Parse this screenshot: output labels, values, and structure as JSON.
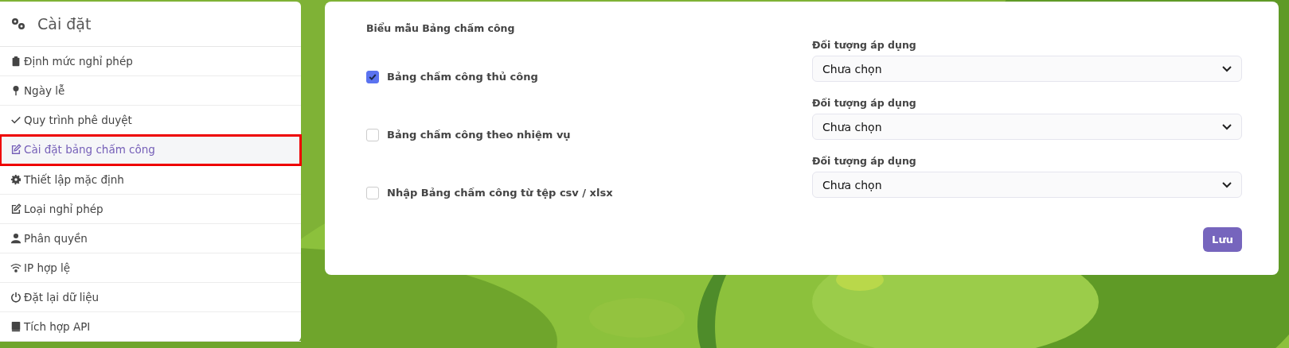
{
  "sidebar": {
    "title": "Cài đặt",
    "items": [
      {
        "label": "Định mức nghỉ phép",
        "selected": false,
        "highlighted": false
      },
      {
        "label": "Ngày lễ",
        "selected": false,
        "highlighted": false
      },
      {
        "label": "Quy trình phê duyệt",
        "selected": false,
        "highlighted": false
      },
      {
        "label": "Cài đặt bảng chấm công",
        "selected": true,
        "highlighted": true
      },
      {
        "label": "Thiết lập mặc định",
        "selected": false,
        "highlighted": false
      },
      {
        "label": "Loại nghỉ phép",
        "selected": false,
        "highlighted": false
      },
      {
        "label": "Phân quyền",
        "selected": false,
        "highlighted": false
      },
      {
        "label": "IP hợp lệ",
        "selected": false,
        "highlighted": false
      },
      {
        "label": "Đặt lại dữ liệu",
        "selected": false,
        "highlighted": false
      },
      {
        "label": "Tích hợp API",
        "selected": false,
        "highlighted": false
      }
    ]
  },
  "form": {
    "title": "Biểu mẫu Bảng chấm công",
    "rows": [
      {
        "label": "Bảng chấm công thủ công",
        "checked": true,
        "select_label": "Đối tượng áp dụng",
        "select_value": "Chưa chọn"
      },
      {
        "label": "Bảng chấm công theo nhiệm vụ",
        "checked": false,
        "select_label": "Đối tượng áp dụng",
        "select_value": "Chưa chọn"
      },
      {
        "label": "Nhập Bảng chấm công từ tệp csv / xlsx",
        "checked": false,
        "select_label": "Đối tượng áp dụng",
        "select_value": "Chưa chọn"
      }
    ],
    "save_button": "Lưu"
  }
}
